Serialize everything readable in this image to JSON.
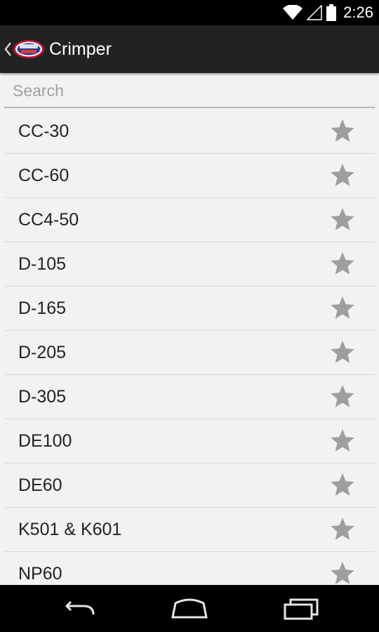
{
  "status_bar": {
    "time": "2:26",
    "icons": [
      "wifi-icon",
      "cell-signal-icon",
      "battery-icon"
    ]
  },
  "action_bar": {
    "title": "Crimper",
    "logo_icon": "app-logo-icon",
    "up_icon": "up-chevron-icon"
  },
  "search": {
    "placeholder": "Search",
    "value": ""
  },
  "items": [
    {
      "label": "CC-30",
      "favorite": false
    },
    {
      "label": "CC-60",
      "favorite": false
    },
    {
      "label": "CC4-50",
      "favorite": false
    },
    {
      "label": "D-105",
      "favorite": false
    },
    {
      "label": "D-165",
      "favorite": false
    },
    {
      "label": "D-205",
      "favorite": false
    },
    {
      "label": "D-305",
      "favorite": false
    },
    {
      "label": "DE100",
      "favorite": false
    },
    {
      "label": "DE60",
      "favorite": false
    },
    {
      "label": "K501 & K601",
      "favorite": false
    },
    {
      "label": "NP60",
      "favorite": false
    }
  ],
  "nav_bar": {
    "buttons": [
      "back-icon",
      "home-icon",
      "recents-icon"
    ]
  },
  "colors": {
    "action_bar": "#222222",
    "list_background": "#f2f2f2",
    "divider": "#d9d9d9",
    "star": "#9e9e9e"
  }
}
